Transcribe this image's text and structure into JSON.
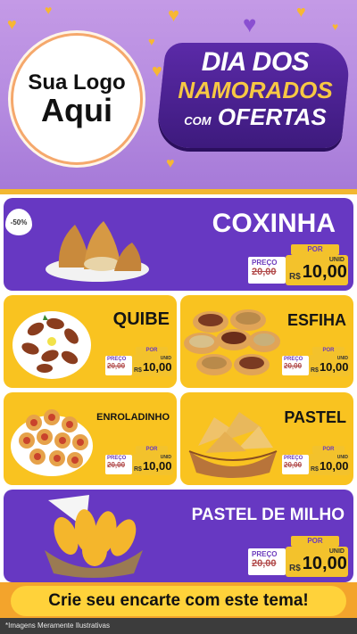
{
  "header": {
    "logo_line1": "Sua Logo",
    "logo_line2": "Aqui",
    "title_line1": "DIA DOS",
    "title_line2": "NAMORADOS",
    "title_com": "COM",
    "title_line3": "OFERTAS"
  },
  "discount_badge": "-50%",
  "products": [
    {
      "name": "COXINHA",
      "por": "POR",
      "preco": "PREÇO",
      "old_price": "20,00",
      "currency": "R$",
      "price": "10,00",
      "unit": "UNID"
    },
    {
      "name": "QUIBE",
      "por": "POR",
      "preco": "PREÇO",
      "old_price": "20,00",
      "currency": "R$",
      "price": "10,00",
      "unit": "UNID"
    },
    {
      "name": "ESFIHA",
      "por": "POR",
      "preco": "PREÇO",
      "old_price": "20,00",
      "currency": "R$",
      "price": "10,00",
      "unit": "UNID"
    },
    {
      "name": "ENROLADINHO",
      "por": "POR",
      "preco": "PREÇO",
      "old_price": "20,00",
      "currency": "R$",
      "price": "10,00",
      "unit": "UNID"
    },
    {
      "name": "PASTEL",
      "por": "POR",
      "preco": "PREÇO",
      "old_price": "20,00",
      "currency": "R$",
      "price": "10,00",
      "unit": "UNID"
    },
    {
      "name": "PASTEL DE MILHO",
      "por": "POR",
      "preco": "PREÇO",
      "old_price": "20,00",
      "currency": "R$",
      "price": "10,00",
      "unit": "UNID"
    }
  ],
  "cta": "Crie seu encarte com este tema!",
  "disclaimer": "*Imagens Meramente Ilustrativas",
  "colors": {
    "purple": "#6738c2",
    "yellow": "#f9c320",
    "header": "#b58be0",
    "accent": "#f3a42c"
  }
}
